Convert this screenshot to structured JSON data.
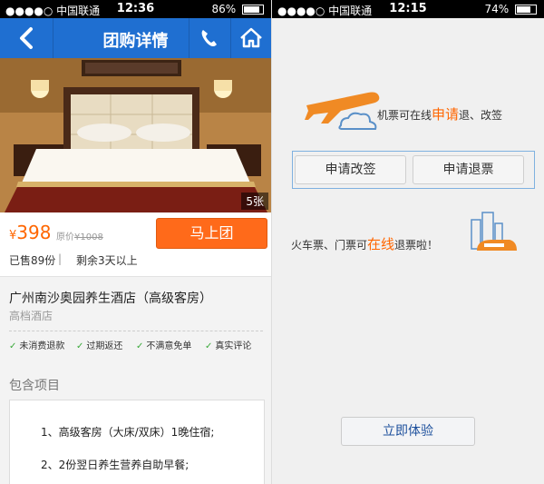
{
  "left": {
    "status": {
      "carrier": "●●●●○ 中国联通",
      "time": "12:36",
      "battery": "86%"
    },
    "nav": {
      "title": "团购详情"
    },
    "image_count": "5张",
    "price": {
      "currency": "¥",
      "value": "398",
      "original_label": "原价",
      "original_value": "¥1008"
    },
    "buy_button": "马上团",
    "sold": "已售89份",
    "separator": "|",
    "remaining": "剩余3天以上",
    "hotel_name": "广州南沙奥园养生酒店（高级客房）",
    "hotel_type": "高档酒店",
    "tags": [
      "未消费退款",
      "过期返还",
      "不满意免单",
      "真实评论"
    ],
    "included_title": "包含项目",
    "included_items": [
      "1、高级客房（大床/双床）1晚住宿;",
      "2、2份翌日养生营养自助早餐;"
    ]
  },
  "right": {
    "status": {
      "carrier": "●●●●○ 中国联通",
      "time": "12:15",
      "battery": "74%"
    },
    "plane_text_before": "机票可在线",
    "plane_text_highlight": "申请",
    "plane_text_after": "退、改签",
    "change_button": "申请改签",
    "refund_button": "申请退票",
    "train_text_before": "火车票、门票可",
    "train_text_highlight": "在线",
    "train_text_after": "退票啦！",
    "try_button": "立即体验"
  },
  "colors": {
    "nav_blue": "#1f6fd1",
    "accent_orange": "#ff6600",
    "check_green": "#3aa93a"
  }
}
